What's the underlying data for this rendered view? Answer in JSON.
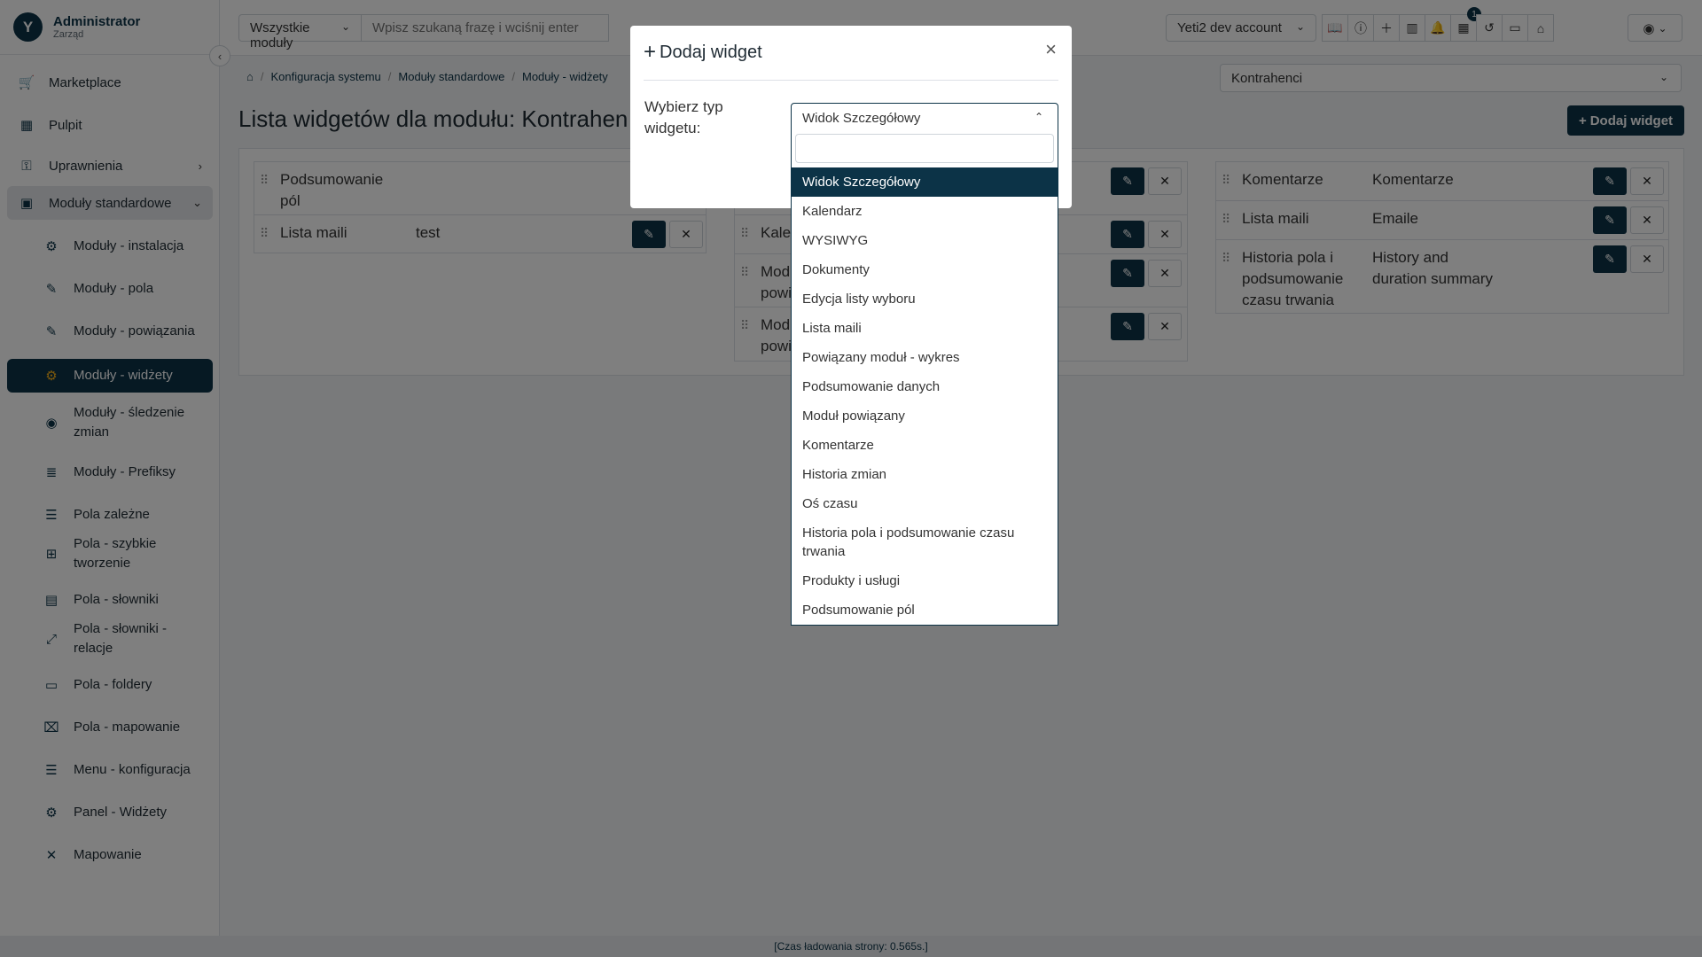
{
  "brand": {
    "name": "Administrator",
    "subtitle": "Zarząd",
    "logo_letter": "Y"
  },
  "sidebar": {
    "items": [
      {
        "label": "Marketplace",
        "icon": "marketplace-icon"
      },
      {
        "label": "Pulpit",
        "icon": "dashboard-icon"
      },
      {
        "label": "Uprawnienia",
        "icon": "permissions-icon"
      },
      {
        "label": "Moduły standardowe",
        "icon": "modules-icon"
      }
    ],
    "subitems": [
      {
        "label": "Moduły - instalacja",
        "icon": "install-icon"
      },
      {
        "label": "Moduły - pola",
        "icon": "fields-icon"
      },
      {
        "label": "Moduły - powiązania",
        "icon": "relations-icon"
      },
      {
        "label": "Moduły - widżety",
        "icon": "widgets-icon"
      },
      {
        "label": "Moduły - śledzenie zmian",
        "icon": "tracking-icon"
      },
      {
        "label": "Moduły - Prefiksy",
        "icon": "prefix-icon"
      },
      {
        "label": "Pola zależne",
        "icon": "dependent-fields-icon"
      },
      {
        "label": "Pola - szybkie tworzenie",
        "icon": "quick-create-icon"
      },
      {
        "label": "Pola - słowniki",
        "icon": "picklists-icon"
      },
      {
        "label": "Pola - słowniki - relacje",
        "icon": "picklist-relations-icon"
      },
      {
        "label": "Pola - foldery",
        "icon": "folders-icon"
      },
      {
        "label": "Pola - mapowanie",
        "icon": "mapping-icon"
      },
      {
        "label": "Menu - konfiguracja",
        "icon": "menu-config-icon"
      },
      {
        "label": "Panel - Widżety",
        "icon": "panel-widgets-icon"
      },
      {
        "label": "Mapowanie",
        "icon": "compress-icon"
      }
    ]
  },
  "topbar": {
    "module_select": "Wszystkie moduły",
    "search_placeholder": "Wpisz szukaną frazę i wciśnij enter",
    "account": "Yeti2 dev account",
    "notification_badge": "1"
  },
  "breadcrumb": [
    "Konfiguracja systemu",
    "Moduły standardowe",
    "Moduły - widżety"
  ],
  "module_filter": "Kontrahenci",
  "page": {
    "title": "Lista widgetów dla modułu: Kontrahenci",
    "add_button": "Dodaj widget"
  },
  "columns": {
    "left": [
      {
        "name": "Podsumowanie pól",
        "title": ""
      },
      {
        "name": "Lista maili",
        "title": "test"
      }
    ],
    "middle": [
      {
        "name": "Kalendarz",
        "title": ""
      },
      {
        "name": "Moduł powiązany",
        "title": ""
      },
      {
        "name": "Moduł powiązany",
        "title": ""
      }
    ],
    "right": [
      {
        "name": "Komentarze",
        "title": "Komentarze"
      },
      {
        "name": "Lista maili",
        "title": "Emaile"
      },
      {
        "name": "Historia pola i podsumowanie czasu trwania",
        "title": "History and duration summary"
      }
    ]
  },
  "modal": {
    "title": "Dodaj widget",
    "field_label": "Wybierz typ widgetu:",
    "selected": "Widok Szczegółowy",
    "options": [
      "Widok Szczegółowy",
      "Kalendarz",
      "WYSIWYG",
      "Dokumenty",
      "Edycja listy wyboru",
      "Lista maili",
      "Powiązany moduł - wykres",
      "Podsumowanie danych",
      "Moduł powiązany",
      "Komentarze",
      "Historia zmian",
      "Oś czasu",
      "Historia pola i podsumowanie czasu trwania",
      "Produkty i usługi",
      "Podsumowanie pól"
    ]
  },
  "footer": "[Czas ładowania strony: 0.565s.]"
}
